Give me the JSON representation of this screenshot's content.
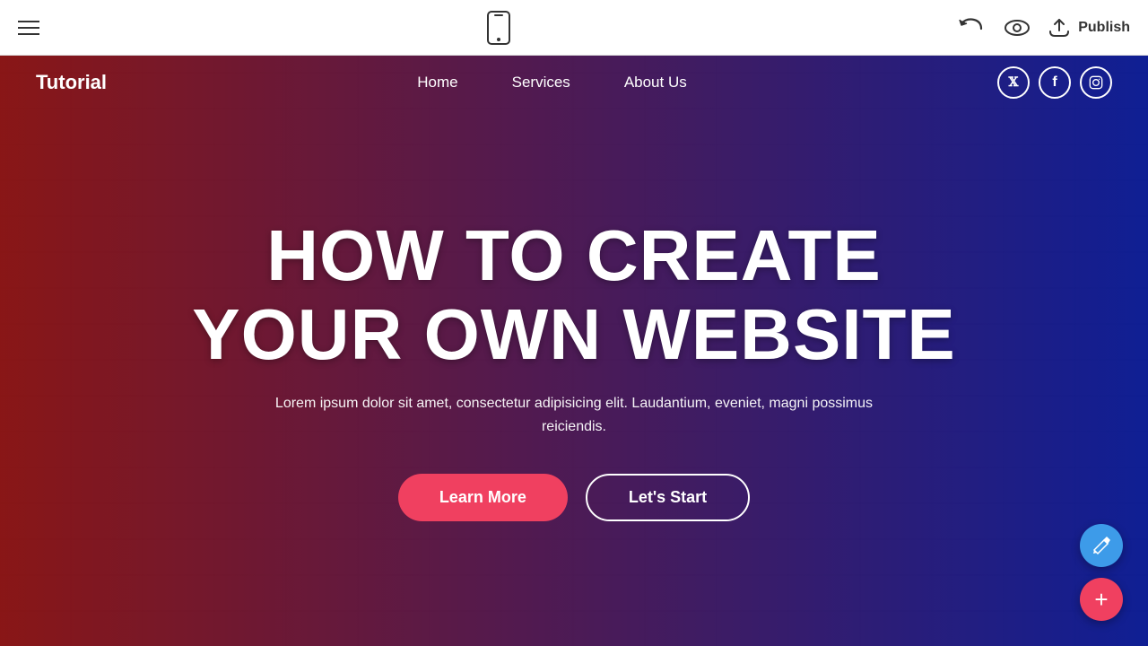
{
  "toolbar": {
    "publish_label": "Publish",
    "hamburger_label": "Menu",
    "mobile_preview_label": "Mobile Preview",
    "undo_label": "Undo",
    "preview_label": "Preview"
  },
  "site": {
    "logo": "Tutorial",
    "nav": {
      "links": [
        {
          "label": "Home",
          "id": "home"
        },
        {
          "label": "Services",
          "id": "services"
        },
        {
          "label": "About Us",
          "id": "about"
        }
      ],
      "socials": [
        {
          "name": "twitter",
          "icon": "𝕏"
        },
        {
          "name": "facebook",
          "icon": "f"
        },
        {
          "name": "instagram",
          "icon": "📷"
        }
      ]
    },
    "hero": {
      "title_line1": "HOW TO CREATE",
      "title_line2": "YOUR OWN WEBSITE",
      "subtitle": "Lorem ipsum dolor sit amet, consectetur adipisicing elit. Laudantium, eveniet, magni possimus reiciendis.",
      "btn_primary": "Learn More",
      "btn_secondary": "Let's Start"
    }
  },
  "fab": {
    "edit_icon": "✏",
    "add_icon": "+"
  }
}
